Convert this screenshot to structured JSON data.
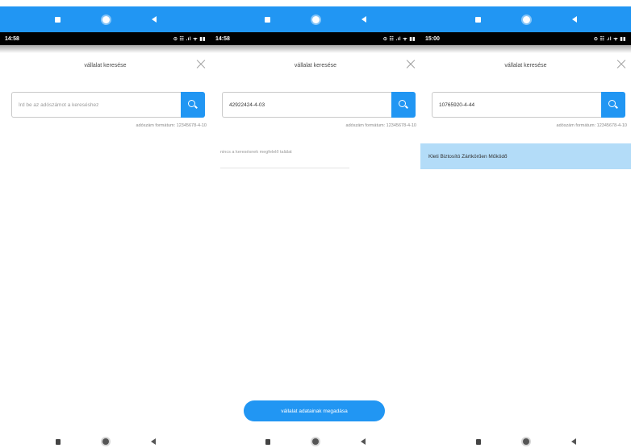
{
  "panels": [
    {
      "status_time": "14:58",
      "status_icons": "⊙ ☷ .ıl ᯤ ▮▮",
      "title": "vállalat keresése",
      "search": {
        "value": "",
        "placeholder": "Írd be az adószámot a kereséshez"
      },
      "hint": "adószám formátum: 12345678-4-10"
    },
    {
      "status_time": "14:58",
      "status_icons": "⊙ ☷ .ıl ᯤ ▮▮",
      "title": "vállalat keresése",
      "search": {
        "value": "42922424-4-03",
        "placeholder": ""
      },
      "hint": "adószám formátum: 12345678-4-10",
      "no_result": "nincs a keresésnek megfelelő találat",
      "primary_button": "vállalat adatainak megadása"
    },
    {
      "status_time": "15:00",
      "status_icons": "⊙ ☷ .ıl ᯤ ▮▮",
      "title": "vállalat keresése",
      "search": {
        "value": "10765920-4-44",
        "placeholder": ""
      },
      "hint": "adószám formátum: 12345678-4-10",
      "results": [
        "Kleti Biztosító Zártkörűen Működő"
      ]
    }
  ],
  "colors": {
    "accent": "#2196f3",
    "selected_row": "#b3dcf8",
    "status_bar": "#000000"
  },
  "icons": {
    "search": "search-icon",
    "close": "close-icon",
    "nav_recent": "square-icon",
    "nav_home": "circle-icon",
    "nav_back": "back-triangle-icon"
  }
}
